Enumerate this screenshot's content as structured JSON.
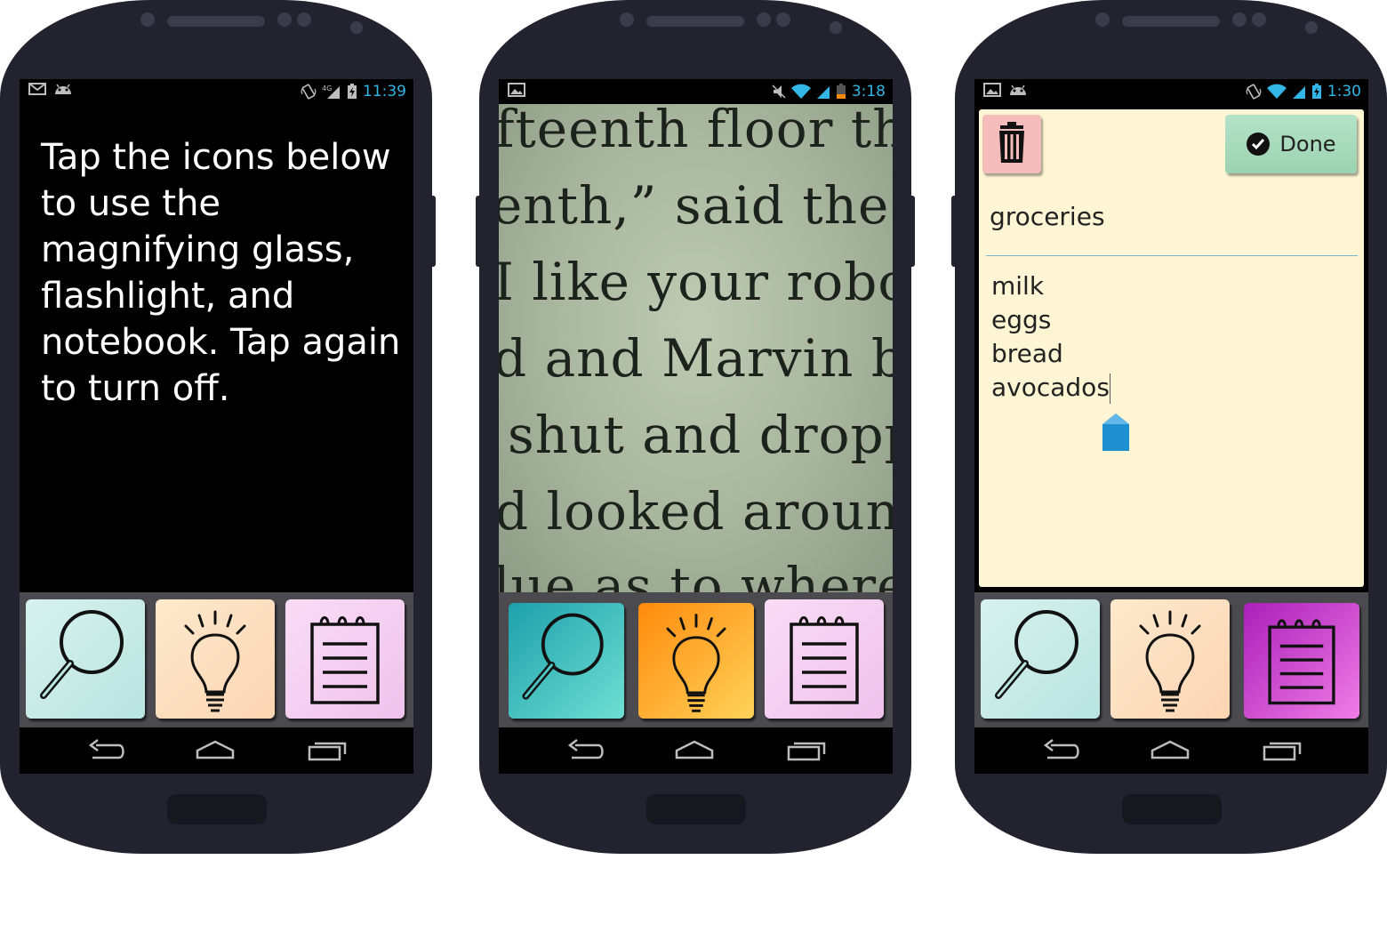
{
  "colors": {
    "phone_body": "#232330",
    "status_accent": "#33b5e5",
    "dock_bg": "#4a4a4f",
    "magnifier_tile": "#c8ece9",
    "flashlight_tile": "#fde2c4",
    "notebook_tile": "#f3cdf0",
    "magnifier_active": "#26a9ad",
    "flashlight_active": "#ff9a22",
    "notebook_active": "#c23fcf",
    "note_bg": "#fdf5d3",
    "trash_btn": "#f5bcbc",
    "done_btn": "#a7d9bb"
  },
  "phones": [
    {
      "status_time": "11:39",
      "status_left_icons": [
        "gmail-icon",
        "android-icon"
      ],
      "status_right_icons": [
        "vibrate-icon",
        "4g-signal-icon",
        "battery-charging-icon"
      ],
      "intro_text": "Tap the icons below to use the magnifying glass, flashlight, and notebook. Tap again to turn off.",
      "active_tool": "none"
    },
    {
      "status_time": "3:18",
      "status_left_icons": [
        "picture-icon"
      ],
      "status_right_icons": [
        "mute-icon",
        "wifi-icon",
        "signal-icon",
        "battery-low-icon"
      ],
      "book_lines": [
        "fteenth floor th",
        "enth,” said the",
        "I like your robo",
        "d and Marvin b",
        "shut and dropp",
        "d looked aroun",
        "lue as to where"
      ],
      "active_tool": "magnifier and flashlight"
    },
    {
      "status_time": "1:30",
      "status_left_icons": [
        "picture-icon",
        "android-icon"
      ],
      "status_right_icons": [
        "vibrate-icon",
        "wifi-icon",
        "signal-icon",
        "battery-charging-icon"
      ],
      "note": {
        "done_label": "Done",
        "title": "groceries",
        "items": [
          "milk",
          "eggs",
          "bread",
          "avocados"
        ]
      },
      "active_tool": "notebook"
    }
  ],
  "dock_icons": [
    "magnifier-icon",
    "lightbulb-icon",
    "notebook-icon"
  ],
  "nav_icons": [
    "back-icon",
    "home-icon",
    "recents-icon"
  ]
}
